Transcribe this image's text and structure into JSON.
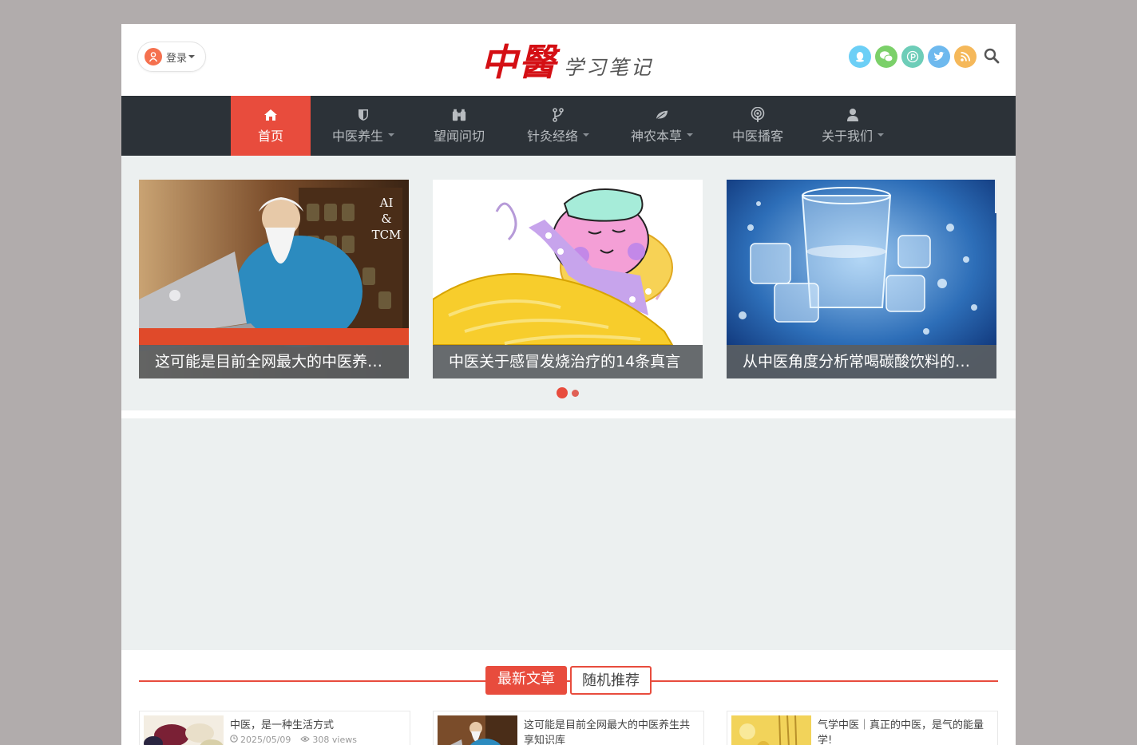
{
  "header": {
    "login_label": "登录",
    "logo_main": "中醫",
    "logo_sub": "学习笔记",
    "social_icons": [
      {
        "name": "qq-icon",
        "color": "#6ccff6"
      },
      {
        "name": "wechat-icon",
        "color": "#7bd069"
      },
      {
        "name": "pixiv-icon",
        "color": "#6dcdb8"
      },
      {
        "name": "twitter-icon",
        "color": "#6eb9ee"
      },
      {
        "name": "rss-icon",
        "color": "#f5b85a"
      }
    ]
  },
  "nav": {
    "items": [
      {
        "label": "首页",
        "icon": "home-icon",
        "active": true,
        "dropdown": false
      },
      {
        "label": "中医养生",
        "icon": "shield-icon",
        "active": false,
        "dropdown": true
      },
      {
        "label": "望闻问切",
        "icon": "binoculars-icon",
        "active": false,
        "dropdown": false
      },
      {
        "label": "针灸经络",
        "icon": "code-fork-icon",
        "active": false,
        "dropdown": true
      },
      {
        "label": "神农本草",
        "icon": "leaf-icon",
        "active": false,
        "dropdown": true
      },
      {
        "label": "中医播客",
        "icon": "podcast-icon",
        "active": false,
        "dropdown": false
      },
      {
        "label": "关于我们",
        "icon": "user-icon",
        "active": false,
        "dropdown": true
      }
    ]
  },
  "slider": {
    "slides": [
      {
        "caption": "这可能是目前全网最大的中医养…",
        "image_text": [
          "AI",
          "&",
          "TCM"
        ]
      },
      {
        "caption": "中医关于感冒发烧治疗的14条真言"
      },
      {
        "caption": "从中医角度分析常喝碳酸饮料的…"
      }
    ]
  },
  "tabs": {
    "latest": "最新文章",
    "random": "随机推荐"
  },
  "articles": [
    {
      "title": "中医，是一种生活方式",
      "date": "2025/05/09",
      "views": "308 views"
    },
    {
      "title": "这可能是目前全网最大的中医养生共享知识库"
    },
    {
      "title": "气学中医｜真正的中医，是气的能量学!"
    }
  ]
}
